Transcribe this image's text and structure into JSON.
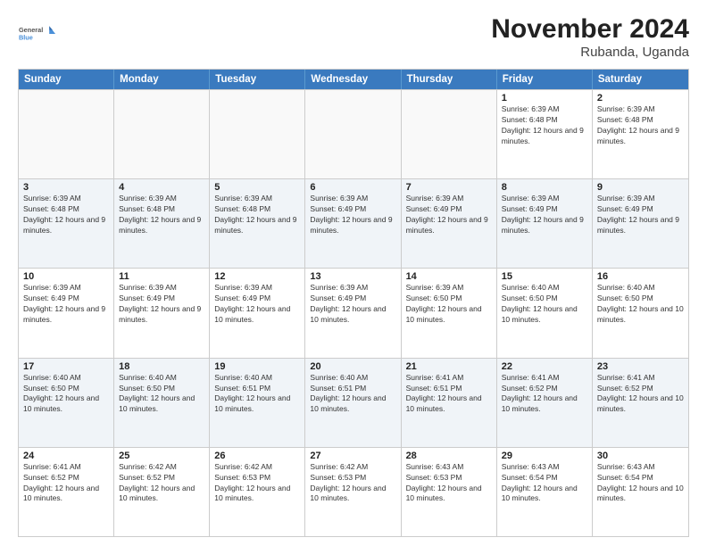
{
  "logo": {
    "line1": "General",
    "line2": "Blue"
  },
  "title": "November 2024",
  "subtitle": "Rubanda, Uganda",
  "weekdays": [
    "Sunday",
    "Monday",
    "Tuesday",
    "Wednesday",
    "Thursday",
    "Friday",
    "Saturday"
  ],
  "weeks": [
    [
      {
        "day": "",
        "empty": true
      },
      {
        "day": "",
        "empty": true
      },
      {
        "day": "",
        "empty": true
      },
      {
        "day": "",
        "empty": true
      },
      {
        "day": "",
        "empty": true
      },
      {
        "day": "1",
        "sunrise": "6:39 AM",
        "sunset": "6:48 PM",
        "daylight": "12 hours and 9 minutes."
      },
      {
        "day": "2",
        "sunrise": "6:39 AM",
        "sunset": "6:48 PM",
        "daylight": "12 hours and 9 minutes."
      }
    ],
    [
      {
        "day": "3",
        "sunrise": "6:39 AM",
        "sunset": "6:48 PM",
        "daylight": "12 hours and 9 minutes."
      },
      {
        "day": "4",
        "sunrise": "6:39 AM",
        "sunset": "6:48 PM",
        "daylight": "12 hours and 9 minutes."
      },
      {
        "day": "5",
        "sunrise": "6:39 AM",
        "sunset": "6:48 PM",
        "daylight": "12 hours and 9 minutes."
      },
      {
        "day": "6",
        "sunrise": "6:39 AM",
        "sunset": "6:49 PM",
        "daylight": "12 hours and 9 minutes."
      },
      {
        "day": "7",
        "sunrise": "6:39 AM",
        "sunset": "6:49 PM",
        "daylight": "12 hours and 9 minutes."
      },
      {
        "day": "8",
        "sunrise": "6:39 AM",
        "sunset": "6:49 PM",
        "daylight": "12 hours and 9 minutes."
      },
      {
        "day": "9",
        "sunrise": "6:39 AM",
        "sunset": "6:49 PM",
        "daylight": "12 hours and 9 minutes."
      }
    ],
    [
      {
        "day": "10",
        "sunrise": "6:39 AM",
        "sunset": "6:49 PM",
        "daylight": "12 hours and 9 minutes."
      },
      {
        "day": "11",
        "sunrise": "6:39 AM",
        "sunset": "6:49 PM",
        "daylight": "12 hours and 9 minutes."
      },
      {
        "day": "12",
        "sunrise": "6:39 AM",
        "sunset": "6:49 PM",
        "daylight": "12 hours and 10 minutes."
      },
      {
        "day": "13",
        "sunrise": "6:39 AM",
        "sunset": "6:49 PM",
        "daylight": "12 hours and 10 minutes."
      },
      {
        "day": "14",
        "sunrise": "6:39 AM",
        "sunset": "6:50 PM",
        "daylight": "12 hours and 10 minutes."
      },
      {
        "day": "15",
        "sunrise": "6:40 AM",
        "sunset": "6:50 PM",
        "daylight": "12 hours and 10 minutes."
      },
      {
        "day": "16",
        "sunrise": "6:40 AM",
        "sunset": "6:50 PM",
        "daylight": "12 hours and 10 minutes."
      }
    ],
    [
      {
        "day": "17",
        "sunrise": "6:40 AM",
        "sunset": "6:50 PM",
        "daylight": "12 hours and 10 minutes."
      },
      {
        "day": "18",
        "sunrise": "6:40 AM",
        "sunset": "6:50 PM",
        "daylight": "12 hours and 10 minutes."
      },
      {
        "day": "19",
        "sunrise": "6:40 AM",
        "sunset": "6:51 PM",
        "daylight": "12 hours and 10 minutes."
      },
      {
        "day": "20",
        "sunrise": "6:40 AM",
        "sunset": "6:51 PM",
        "daylight": "12 hours and 10 minutes."
      },
      {
        "day": "21",
        "sunrise": "6:41 AM",
        "sunset": "6:51 PM",
        "daylight": "12 hours and 10 minutes."
      },
      {
        "day": "22",
        "sunrise": "6:41 AM",
        "sunset": "6:52 PM",
        "daylight": "12 hours and 10 minutes."
      },
      {
        "day": "23",
        "sunrise": "6:41 AM",
        "sunset": "6:52 PM",
        "daylight": "12 hours and 10 minutes."
      }
    ],
    [
      {
        "day": "24",
        "sunrise": "6:41 AM",
        "sunset": "6:52 PM",
        "daylight": "12 hours and 10 minutes."
      },
      {
        "day": "25",
        "sunrise": "6:42 AM",
        "sunset": "6:52 PM",
        "daylight": "12 hours and 10 minutes."
      },
      {
        "day": "26",
        "sunrise": "6:42 AM",
        "sunset": "6:53 PM",
        "daylight": "12 hours and 10 minutes."
      },
      {
        "day": "27",
        "sunrise": "6:42 AM",
        "sunset": "6:53 PM",
        "daylight": "12 hours and 10 minutes."
      },
      {
        "day": "28",
        "sunrise": "6:43 AM",
        "sunset": "6:53 PM",
        "daylight": "12 hours and 10 minutes."
      },
      {
        "day": "29",
        "sunrise": "6:43 AM",
        "sunset": "6:54 PM",
        "daylight": "12 hours and 10 minutes."
      },
      {
        "day": "30",
        "sunrise": "6:43 AM",
        "sunset": "6:54 PM",
        "daylight": "12 hours and 10 minutes."
      }
    ]
  ]
}
